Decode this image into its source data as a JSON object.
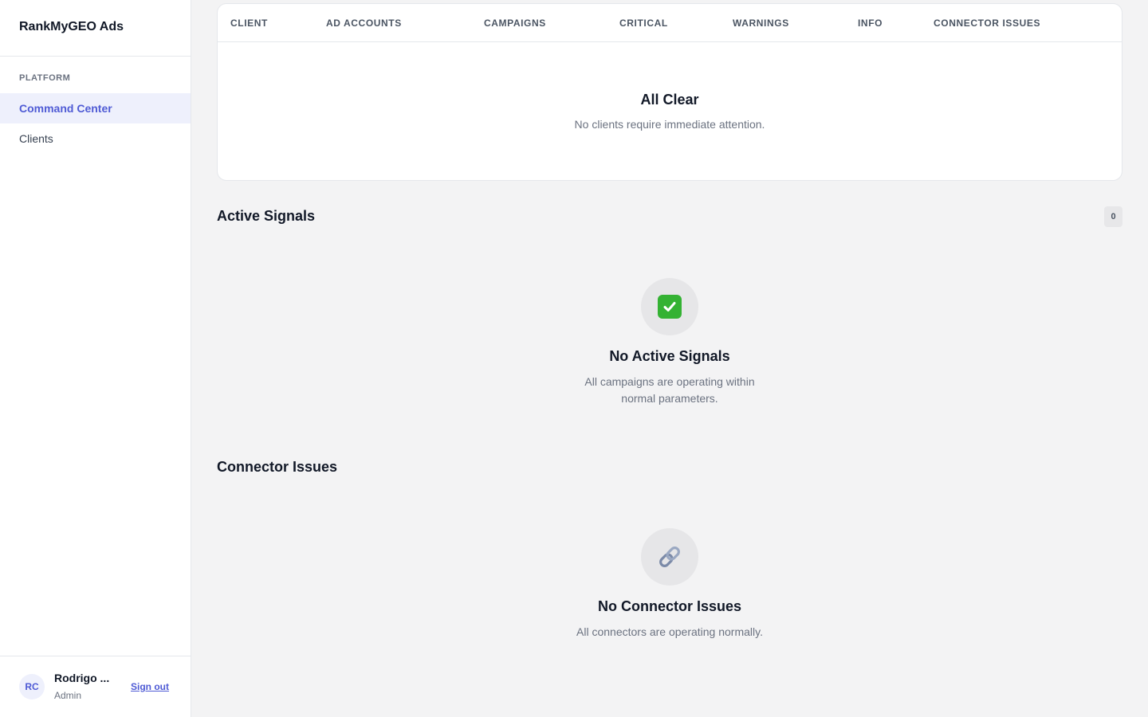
{
  "app": {
    "brand": "RankMyGEO Ads"
  },
  "sidebar": {
    "section_label": "PLATFORM",
    "items": [
      {
        "label": "Command Center",
        "active": true
      },
      {
        "label": "Clients",
        "active": false
      }
    ],
    "user": {
      "initials": "RC",
      "name": "Rodrigo ...",
      "role": "Admin",
      "signout_label": "Sign out"
    }
  },
  "clients_table": {
    "columns": [
      "CLIENT",
      "AD ACCOUNTS",
      "CAMPAIGNS",
      "CRITICAL",
      "WARNINGS",
      "INFO",
      "CONNECTOR ISSUES"
    ],
    "empty_title": "All Clear",
    "empty_desc": "No clients require immediate attention."
  },
  "active_signals": {
    "title": "Active Signals",
    "count": "0",
    "icon": "check-mark-icon",
    "empty_title": "No Active Signals",
    "empty_desc_line1": "All campaigns are operating within",
    "empty_desc_line2": "normal parameters."
  },
  "connector_issues": {
    "title": "Connector Issues",
    "icon": "link-icon",
    "empty_title": "No Connector Issues",
    "empty_desc": "All connectors are operating normally."
  },
  "colors": {
    "accent": "#4f5bd5",
    "accent_bg": "#eef0fc",
    "page_bg": "#f3f3f4",
    "success": "#34b233"
  }
}
